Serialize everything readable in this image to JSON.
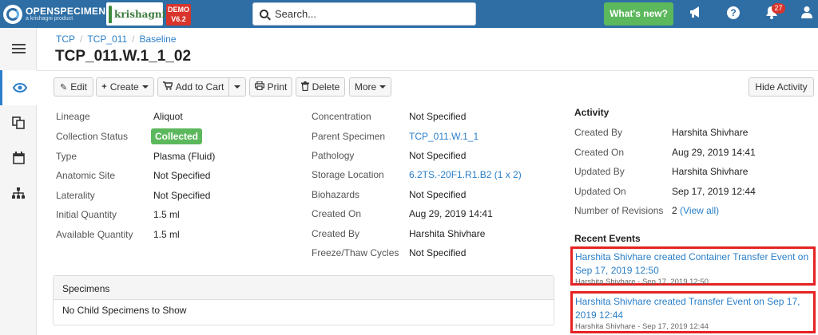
{
  "brand": {
    "name": "OPENSPECIMEN",
    "tagline": "a krishagni product",
    "partner": "krishagni",
    "demo_line1": "DEMO",
    "demo_line2": "V6.2"
  },
  "search": {
    "placeholder": "Search..."
  },
  "topbar": {
    "whats_new": "What's new?",
    "notifications_count": "27"
  },
  "breadcrumb": [
    "TCP",
    "TCP_011",
    "Baseline"
  ],
  "page_title": "TCP_011.W.1_1_02",
  "toolbar": {
    "edit": "Edit",
    "create": "Create",
    "add_to_cart": "Add to Cart",
    "print": "Print",
    "delete": "Delete",
    "more": "More",
    "hide_activity": "Hide Activity"
  },
  "details_left": [
    {
      "label": "Lineage",
      "value": "Aliquot"
    },
    {
      "label": "Collection Status",
      "value": "Collected"
    },
    {
      "label": "Type",
      "value": "Plasma (Fluid)"
    },
    {
      "label": "Anatomic Site",
      "value": "Not Specified"
    },
    {
      "label": "Laterality",
      "value": "Not Specified"
    },
    {
      "label": "Initial Quantity",
      "value": "1.5 ml"
    },
    {
      "label": "Available Quantity",
      "value": "1.5 ml"
    }
  ],
  "details_right": [
    {
      "label": "Concentration",
      "value": "Not Specified"
    },
    {
      "label": "Parent Specimen",
      "value": "TCP_011.W.1_1"
    },
    {
      "label": "Pathology",
      "value": "Not Specified"
    },
    {
      "label": "Storage Location",
      "value": "6.2TS.-20F1.R1.B2 (1 x 2)"
    },
    {
      "label": "Biohazards",
      "value": "Not Specified"
    },
    {
      "label": "Created On",
      "value": "Aug 29, 2019 14:41"
    },
    {
      "label": "Created By",
      "value": "Harshita Shivhare"
    },
    {
      "label": "Freeze/Thaw Cycles",
      "value": "Not Specified"
    }
  ],
  "activity": {
    "heading": "Activity",
    "rows": [
      {
        "label": "Created By",
        "value": "Harshita Shivhare"
      },
      {
        "label": "Created On",
        "value": "Aug 29, 2019 14:41"
      },
      {
        "label": "Updated By",
        "value": "Harshita Shivhare"
      },
      {
        "label": "Updated On",
        "value": "Sep 17, 2019 12:44"
      },
      {
        "label": "Number of Revisions",
        "value": "2",
        "link": "(View all)"
      }
    ]
  },
  "recent_events": {
    "heading": "Recent Events",
    "items": [
      {
        "title": "Harshita Shivhare created Container Transfer Event on Sep 17, 2019 12:50",
        "meta": "Harshita Shivhare - Sep 17, 2019 12:50"
      },
      {
        "title": "Harshita Shivhare created Transfer Event on Sep 17, 2019 12:44",
        "meta": "Harshita Shivhare - Sep 17, 2019 12:44"
      }
    ]
  },
  "specimens_panel": {
    "heading": "Specimens",
    "empty_text": "No Child Specimens to Show"
  },
  "colors": {
    "navbar": "#2e6ea5",
    "accent": "#2a7fc9",
    "success": "#5cb85c",
    "danger": "#d9342b",
    "highlight": "#e52222"
  },
  "icons": [
    "hamburger-icon",
    "eye-icon",
    "copy-icon",
    "calendar-icon",
    "sitemap-icon",
    "search-icon",
    "megaphone-icon",
    "help-icon",
    "bell-icon",
    "user-icon",
    "pencil-icon",
    "plus-icon",
    "cart-icon",
    "print-icon",
    "trash-icon"
  ]
}
